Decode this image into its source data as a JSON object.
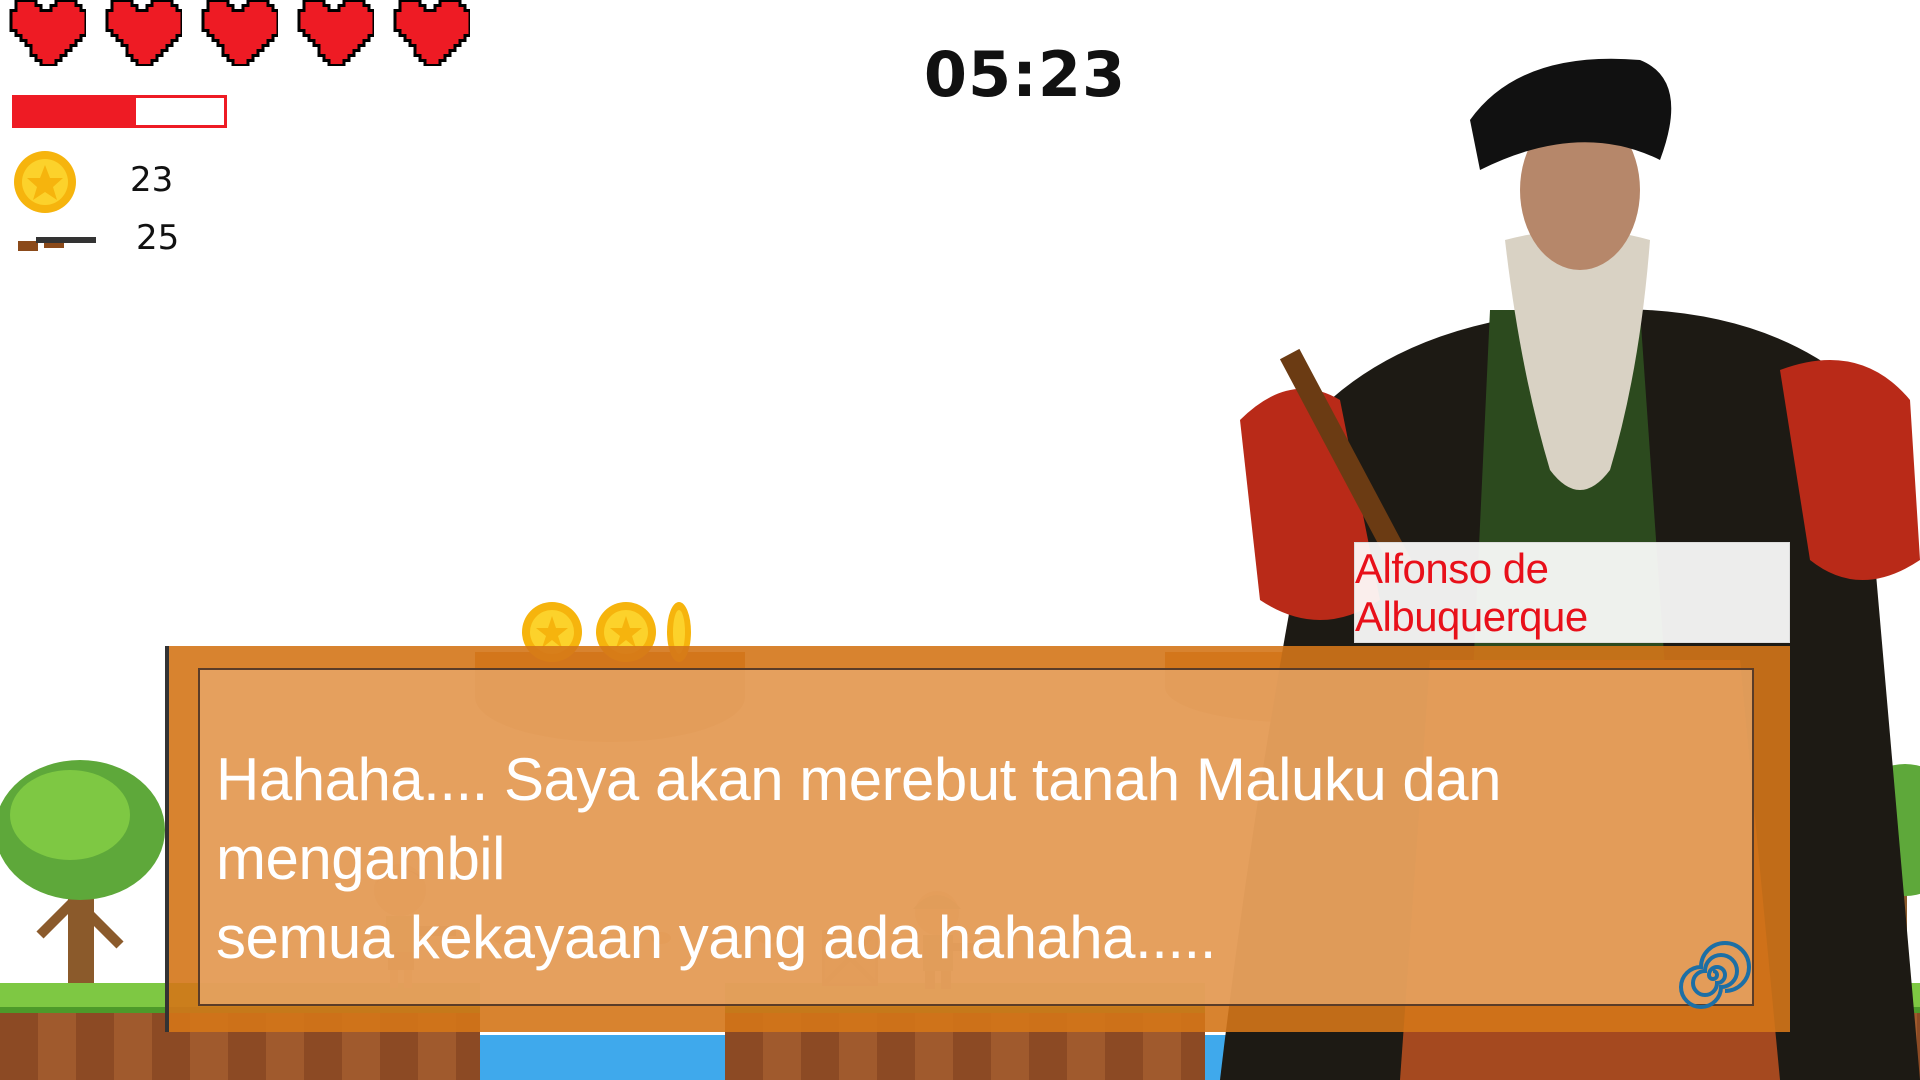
{
  "hud": {
    "lives": 5,
    "health_fraction": 0.58,
    "coins": "23",
    "ammo": "25",
    "timer": "05:23"
  },
  "dialog": {
    "speaker": "Alfonso de Albuquerque",
    "line1": "Hahaha.... Saya akan merebut tanah Maluku dan mengambil",
    "line2": "semua kekayaan yang ada hahaha....."
  },
  "colors": {
    "heart": "#ee1b24",
    "health": "#ee1b24",
    "dialog_bg": "#d47618",
    "speaker_text": "#e8101a"
  },
  "icons": [
    "heart-icon",
    "coin-icon",
    "rifle-icon",
    "next-dialog-icon"
  ]
}
